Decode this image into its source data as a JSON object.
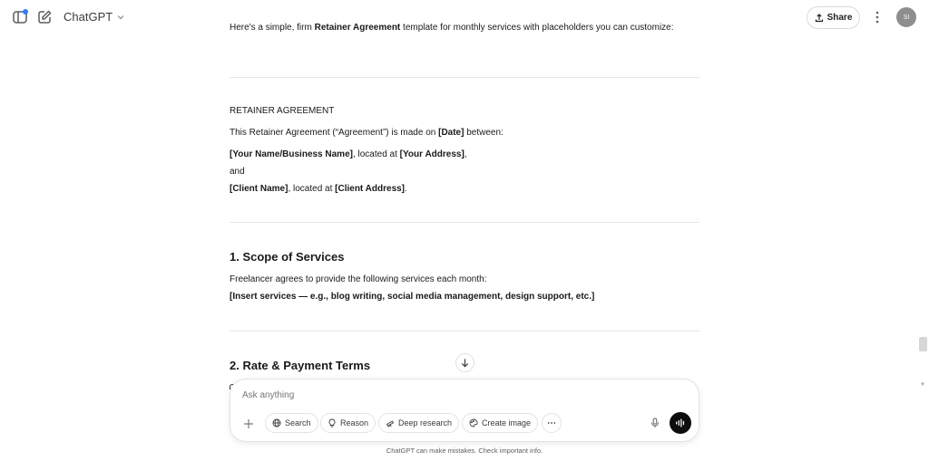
{
  "header": {
    "model_label": "ChatGPT",
    "share_label": "Share",
    "avatar_initials": "SI"
  },
  "message": {
    "intro_prefix": "Here's a simple, firm ",
    "intro_bold": "Retainer Agreement",
    "intro_suffix": " template for monthly services with placeholders you can customize:",
    "agreement_title": "RETAINER AGREEMENT",
    "made_prefix": "This Retainer Agreement (“Agreement”) is made on ",
    "made_date": "[Date]",
    "made_suffix": " between:",
    "party1_name": "[Your Name/Business Name]",
    "party1_mid": ", located at ",
    "party1_addr": "[Your Address]",
    "party1_end": ",",
    "and_text": "and",
    "party2_name": "[Client Name]",
    "party2_mid": ", located at ",
    "party2_addr": "[Client Address]",
    "party2_end": ".",
    "section1_heading": "1. Scope of Services",
    "section1_text": "Freelancer agrees to provide the following services each month:",
    "section1_placeholder": "[Insert services — e.g., blog writing, social media management, design support, etc.]",
    "section2_heading": "2. Rate & Payment Terms"
  },
  "composer": {
    "placeholder": "Ask anything",
    "tools": {
      "search": "Search",
      "reason": "Reason",
      "deep_research": "Deep research",
      "create_image": "Create image"
    }
  },
  "footer": {
    "disclaimer": "ChatGPT can make mistakes. Check important info."
  }
}
